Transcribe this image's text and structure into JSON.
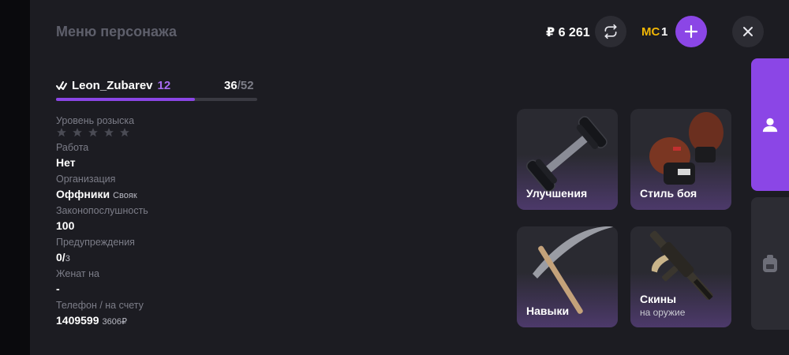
{
  "header": {
    "title": "Меню персонажа",
    "balance": "₽ 6 261",
    "mc_label": "MC",
    "mc_value": "1"
  },
  "profile": {
    "name": "Leon_Zubarev",
    "level": "12",
    "xp_current": "36",
    "xp_max": "/52",
    "xp_progress": 0.69
  },
  "stats": {
    "wanted_label": "Уровень розыска",
    "wanted_stars_filled": 0,
    "wanted_stars_total": 5,
    "job_label": "Работа",
    "job_value": "Нет",
    "org_label": "Организация",
    "org_value": "Оффники",
    "org_rank": "Свояк",
    "law_label": "Законопослушность",
    "law_value": "100",
    "warn_label": "Предупреждения",
    "warn_value": "0/",
    "warn_max": "3",
    "married_label": "Женат на",
    "married_value": "-",
    "phone_label": "Телефон / на счету",
    "phone_value": "1409599",
    "phone_balance": "3606₽"
  },
  "cards": [
    {
      "title": "Улучшения",
      "icon": "dumbbell-icon"
    },
    {
      "title": "Стиль боя",
      "icon": "boxing-gloves-icon"
    },
    {
      "title": "Навыки",
      "icon": "pickaxe-icon"
    },
    {
      "title": "Скины",
      "subtitle": "на оружие",
      "icon": "rifle-icon"
    }
  ],
  "colors": {
    "accent": "#8b46e6",
    "mc": "#f2b705",
    "panel": "#1c1c22",
    "card": "#2a2a31"
  },
  "side_tabs": [
    {
      "icon": "user-icon",
      "active": true
    },
    {
      "icon": "backpack-icon",
      "active": false
    }
  ]
}
